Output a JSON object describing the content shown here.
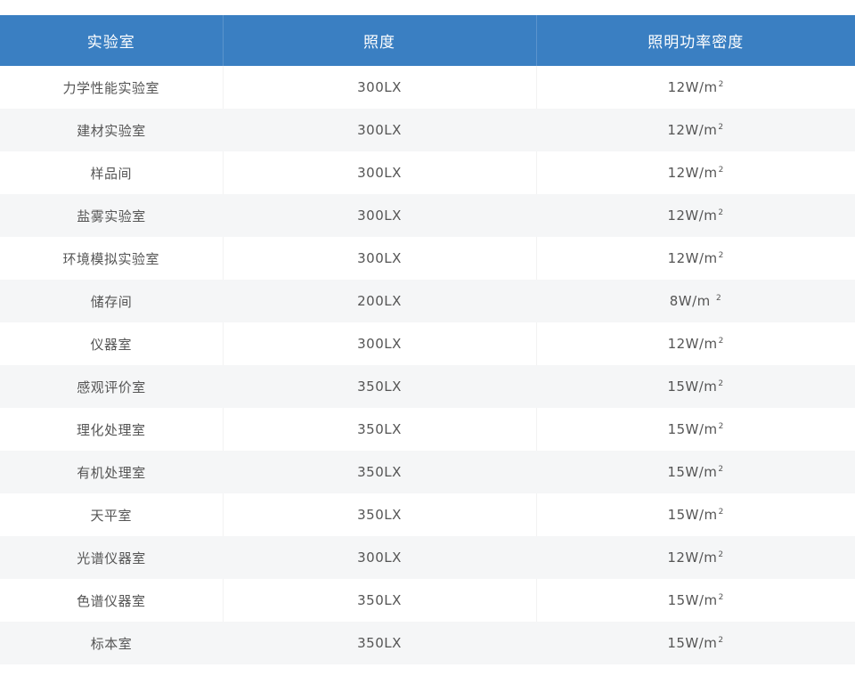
{
  "table": {
    "headers": [
      "实验室",
      "照度",
      "照明功率密度"
    ],
    "rows": [
      {
        "room": "力学性能实验室",
        "illuminance": "300LX",
        "density": "12W/m",
        "unit_sup": "2"
      },
      {
        "room": "建材实验室",
        "illuminance": "300LX",
        "density": "12W/m",
        "unit_sup": "2"
      },
      {
        "room": "样品间",
        "illuminance": "300LX",
        "density": "12W/m",
        "unit_sup": "2"
      },
      {
        "room": "盐雾实验室",
        "illuminance": "300LX",
        "density": "12W/m",
        "unit_sup": "2"
      },
      {
        "room": "环境模拟实验室",
        "illuminance": "300LX",
        "density": "12W/m",
        "unit_sup": "2"
      },
      {
        "room": "储存间",
        "illuminance": "200LX",
        "density": "8W/m ",
        "unit_sup": "2"
      },
      {
        "room": "仪器室",
        "illuminance": "300LX",
        "density": "12W/m",
        "unit_sup": "2"
      },
      {
        "room": "感观评价室",
        "illuminance": "350LX",
        "density": "15W/m",
        "unit_sup": "2"
      },
      {
        "room": "理化处理室",
        "illuminance": "350LX",
        "density": "15W/m",
        "unit_sup": "2"
      },
      {
        "room": "有机处理室",
        "illuminance": "350LX",
        "density": "15W/m",
        "unit_sup": "2"
      },
      {
        "room": "天平室",
        "illuminance": "350LX",
        "density": "15W/m",
        "unit_sup": "2"
      },
      {
        "room": "光谱仪器室",
        "illuminance": "300LX",
        "density": "12W/m",
        "unit_sup": "2"
      },
      {
        "room": "色谱仪器室",
        "illuminance": "350LX",
        "density": "15W/m",
        "unit_sup": "2"
      },
      {
        "room": "标本室",
        "illuminance": "350LX",
        "density": "15W/m",
        "unit_sup": "2"
      }
    ]
  },
  "colors": {
    "header_bg": "#3a7fc2",
    "header_text": "#ffffff",
    "stripe_bg": "#f5f6f7",
    "body_text": "#555555"
  }
}
